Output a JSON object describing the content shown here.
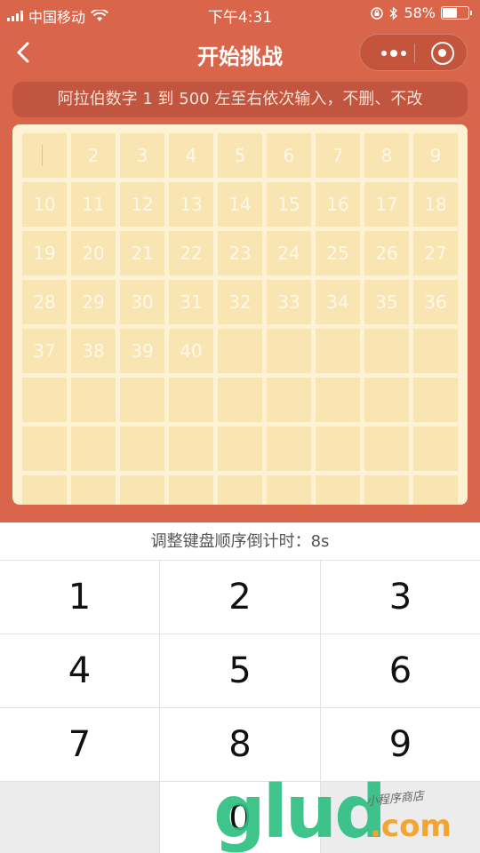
{
  "status_bar": {
    "carrier": "中国移动",
    "time": "下午4:31",
    "battery_text": "58%",
    "battery_level": 0.58
  },
  "nav": {
    "title": "开始挑战",
    "back_icon": "chevron-left-icon",
    "more_icon": "more-dots-icon",
    "close_icon": "target-circle-icon"
  },
  "instruction": "阿拉伯数字 1 到 500 左至右依次输入，不删、不改",
  "grid": {
    "columns": 9,
    "visible_rows": 8,
    "cells": [
      "",
      "2",
      "3",
      "4",
      "5",
      "6",
      "7",
      "8",
      "9",
      "10",
      "11",
      "12",
      "13",
      "14",
      "15",
      "16",
      "17",
      "18",
      "19",
      "20",
      "21",
      "22",
      "23",
      "24",
      "25",
      "26",
      "27",
      "28",
      "29",
      "30",
      "31",
      "32",
      "33",
      "34",
      "35",
      "36",
      "37",
      "38",
      "39",
      "40"
    ],
    "current_index": 0
  },
  "keypad": {
    "countdown": "调整键盘顺序倒计时：8s",
    "keys": [
      "1",
      "2",
      "3",
      "4",
      "5",
      "6",
      "7",
      "8",
      "9",
      "",
      "0",
      ""
    ]
  },
  "watermark": {
    "brand": "glud",
    "domain": ".com",
    "tagline": "小程序商店"
  },
  "colors": {
    "background": "#d9654a",
    "banner": "#c2553f",
    "board": "#fdf2d4",
    "cell": "#f8e5b2",
    "watermark_green": "#2fbf83",
    "watermark_orange": "#f2a531"
  }
}
